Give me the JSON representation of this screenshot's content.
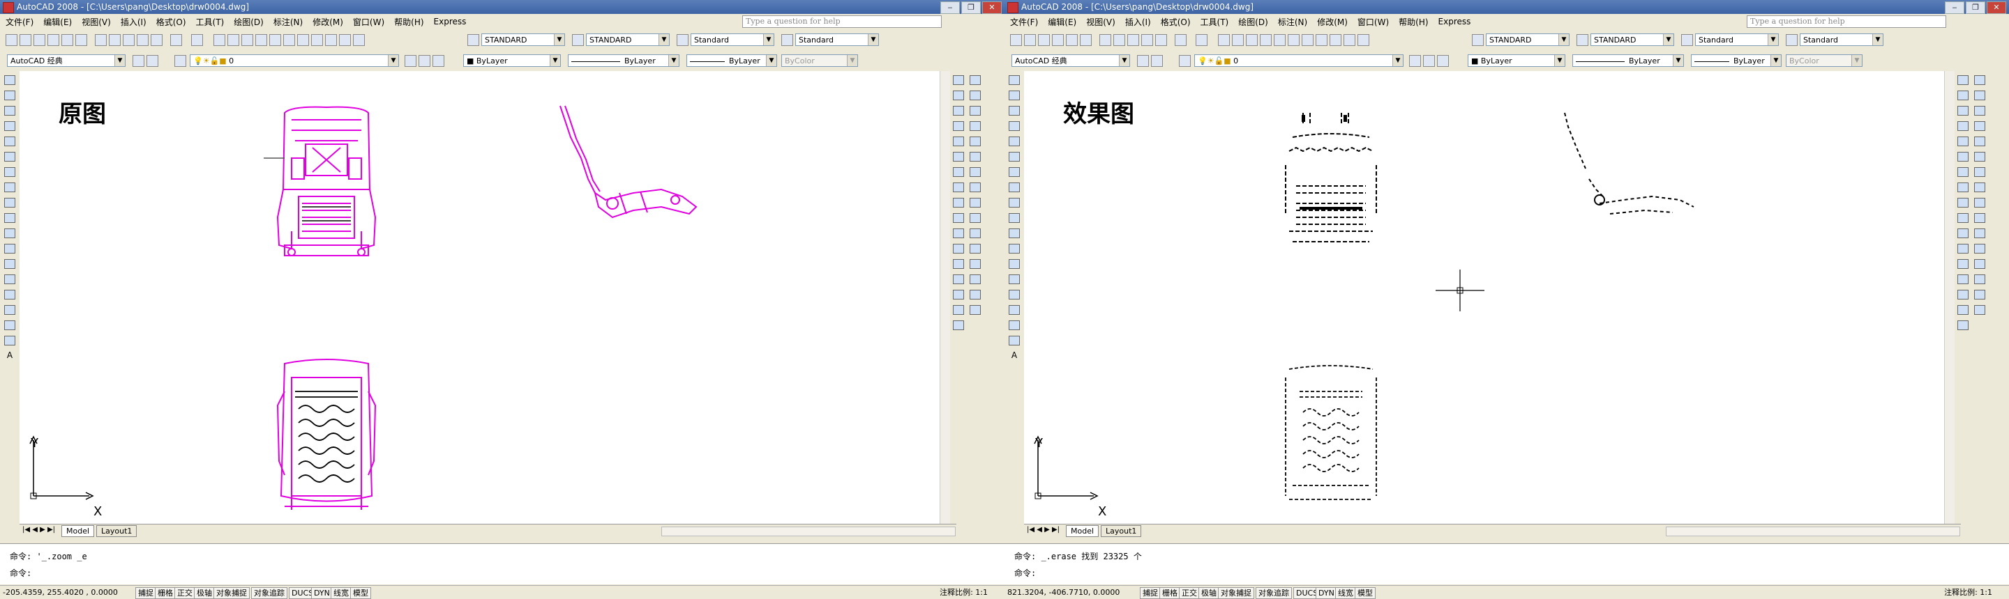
{
  "windows": [
    {
      "side": "left",
      "title": "AutoCAD 2008 - [C:\\Users\\pang\\Desktop\\drw0004.dwg]",
      "menu": [
        "文件(F)",
        "编辑(E)",
        "视图(V)",
        "插入(I)",
        "格式(O)",
        "工具(T)",
        "绘图(D)",
        "标注(N)",
        "修改(M)",
        "窗口(W)",
        "帮助(H)",
        "Express"
      ],
      "search_placeholder": "Type a question for help",
      "styles": {
        "text_style": "STANDARD",
        "dim_style": "STANDARD",
        "table_style": "Standard",
        "mleader_style": "Standard"
      },
      "workspace": "AutoCAD 经典",
      "layer": "0",
      "color": "ByLayer",
      "linetype": "ByLayer",
      "lineweight": "ByLayer",
      "plotstyle": "ByColor",
      "viewport_title": "原图",
      "axis": {
        "x": "X",
        "y": "Y"
      },
      "tabs": [
        "Model",
        "Layout1"
      ],
      "command_history": "命令: '_.zoom _e",
      "command_prompt": "命令:",
      "coordinates": "-205.4359, 255.4020 , 0.0000",
      "status_toggles": [
        "捕捉",
        "栅格",
        "正交",
        "极轴",
        "对象捕捉",
        "对象追踪",
        "DUCS",
        "DYN",
        "线宽",
        "模型"
      ],
      "annotation_scale": "注释比例: 1:1"
    },
    {
      "side": "right",
      "title": "AutoCAD 2008 - [C:\\Users\\pang\\Desktop\\drw0004.dwg]",
      "menu": [
        "文件(F)",
        "编辑(E)",
        "视图(V)",
        "插入(I)",
        "格式(O)",
        "工具(T)",
        "绘图(D)",
        "标注(N)",
        "修改(M)",
        "窗口(W)",
        "帮助(H)",
        "Express"
      ],
      "search_placeholder": "Type a question for help",
      "styles": {
        "text_style": "STANDARD",
        "dim_style": "STANDARD",
        "table_style": "Standard",
        "mleader_style": "Standard"
      },
      "workspace": "AutoCAD 经典",
      "layer": "0",
      "color": "ByLayer",
      "linetype": "ByLayer",
      "lineweight": "ByLayer",
      "plotstyle": "ByColor",
      "viewport_title": "效果图",
      "axis": {
        "x": "X",
        "y": "Y"
      },
      "tabs": [
        "Model",
        "Layout1"
      ],
      "command_history": "命令: _.erase 找到 23325 个",
      "command_prompt": "命令:",
      "coordinates": "821.3204, -406.7710, 0.0000",
      "status_toggles": [
        "捕捉",
        "栅格",
        "正交",
        "极轴",
        "对象捕捉",
        "对象追踪",
        "DUCS",
        "DYN",
        "线宽",
        "模型"
      ],
      "annotation_scale": "注释比例: 1:1"
    }
  ],
  "colors": {
    "drawing_magenta": "#e000e0",
    "drawing_black": "#000000",
    "titlebar": "#3d63a5",
    "chrome": "#ece9d8"
  },
  "icons": [
    "app-icon",
    "minimize-icon",
    "restore-icon",
    "close-icon",
    "line-icon",
    "polyline-icon",
    "circle-icon",
    "arc-icon",
    "move-icon",
    "copy-icon",
    "rotate-icon",
    "zoom-icon",
    "pan-icon",
    "layer-icon",
    "crosshair-icon",
    "ucs-icon"
  ]
}
